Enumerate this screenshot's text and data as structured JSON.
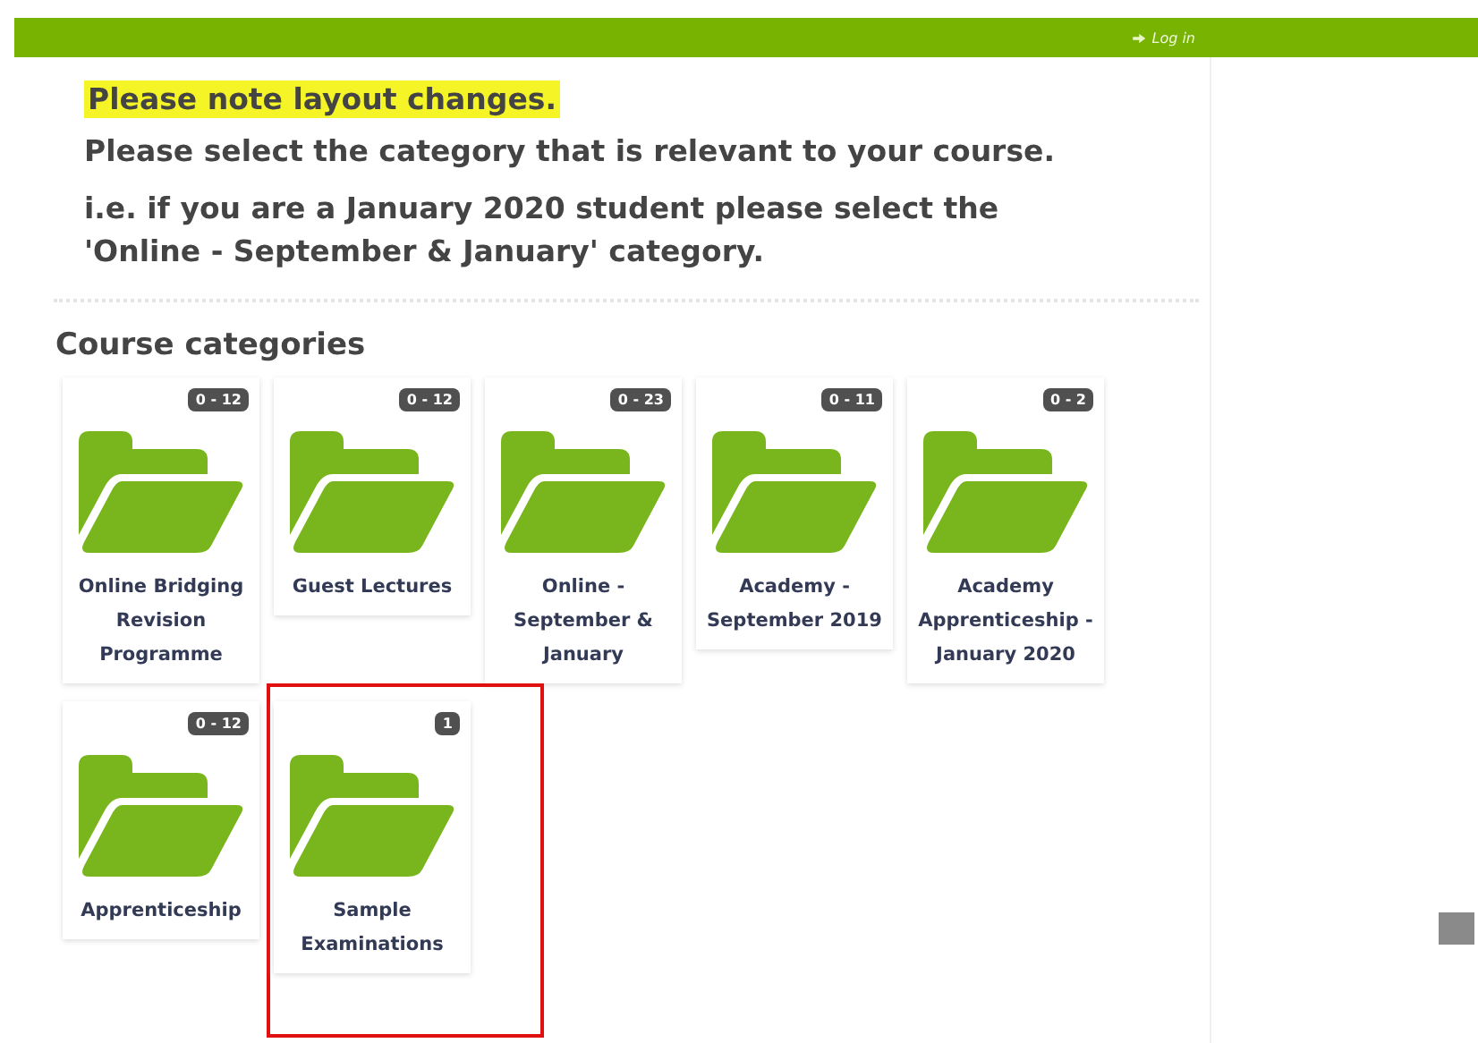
{
  "top_bar": {
    "login_link": "Log in"
  },
  "notice": {
    "highlight": "Please note layout changes.",
    "lines": [
      "Please select the category that is relevant to your course.",
      "i.e. if you are a January 2020 student please select the 'Online - September & January' category."
    ]
  },
  "section_title": "Course categories",
  "categories": [
    {
      "name": "Online Bridging Revision Programme",
      "badge": "0 - 12",
      "highlighted": false
    },
    {
      "name": "Guest Lectures",
      "badge": "0 - 12",
      "highlighted": false
    },
    {
      "name": "Online - September & January",
      "badge": "0 - 23",
      "highlighted": false
    },
    {
      "name": "Academy - September 2019",
      "badge": "0 - 11",
      "highlighted": false
    },
    {
      "name": "Academy Apprenticeship - January 2020",
      "badge": "0 - 2",
      "highlighted": false
    },
    {
      "name": "Apprenticeship",
      "badge": "0 - 12",
      "highlighted": false
    },
    {
      "name": "Sample Examinations",
      "badge": "1",
      "highlighted": true
    }
  ]
}
